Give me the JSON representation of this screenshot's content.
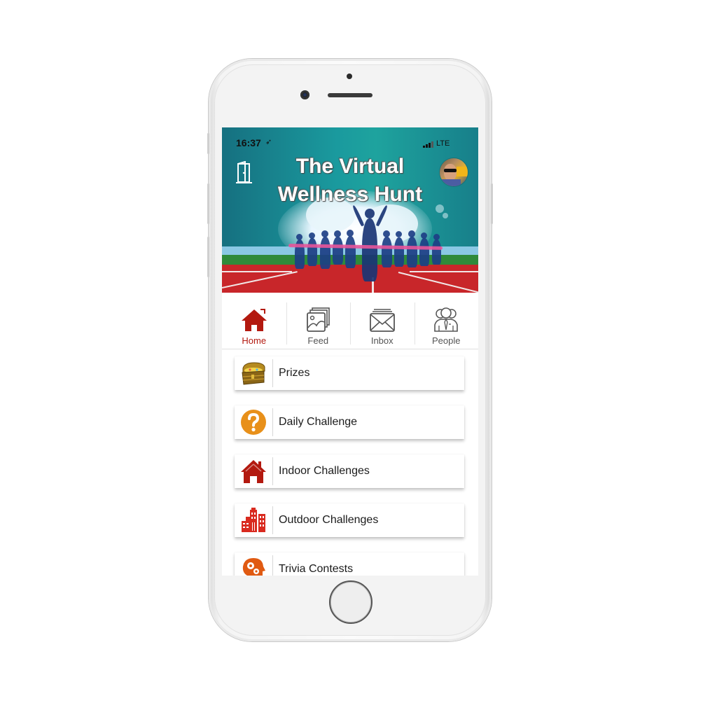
{
  "status_bar": {
    "time": "16:37",
    "location_glyph": "➶",
    "network": "LTE"
  },
  "header": {
    "title": "The Virtual Wellness Hunt",
    "exit_icon": "door-exit-icon",
    "avatar_alt": "profile avatar"
  },
  "tabs": [
    {
      "label": "Home",
      "icon": "home-icon",
      "active": true
    },
    {
      "label": "Feed",
      "icon": "photo-stack-icon",
      "active": false
    },
    {
      "label": "Inbox",
      "icon": "envelope-icon",
      "active": false
    },
    {
      "label": "People",
      "icon": "people-icon",
      "active": false
    }
  ],
  "menu": [
    {
      "label": "Prizes",
      "icon": "treasure-chest-icon"
    },
    {
      "label": "Daily Challenge",
      "icon": "question-circle-icon"
    },
    {
      "label": "Indoor Challenges",
      "icon": "house-icon"
    },
    {
      "label": "Outdoor Challenges",
      "icon": "city-buildings-icon"
    },
    {
      "label": "Trivia Contests",
      "icon": "head-gears-icon"
    }
  ],
  "colors": {
    "accent": "#b3190f",
    "question_orange": "#e8901a",
    "trivia_orange": "#e05a12",
    "header_teal": "#1a9a9e"
  }
}
